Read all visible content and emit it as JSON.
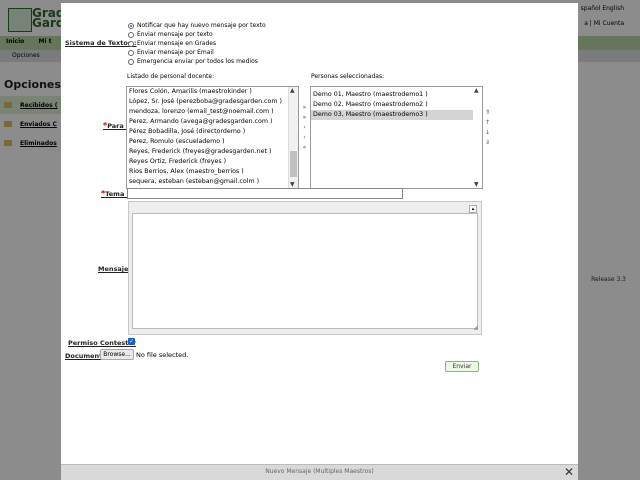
{
  "background": {
    "logo_text": "Grade\nGarde",
    "top_right_langs": "spañol  English",
    "top_right_user": "a | Mi Cuenta",
    "nav": [
      "Inicio",
      "Mi t"
    ],
    "subnav": [
      "Opciones"
    ],
    "page_title": "Opciones",
    "folders": [
      "Recibidos (",
      "Enviados C",
      "Eliminados"
    ],
    "release": "Release 3.3"
  },
  "dialog": {
    "title": "Nuevo Mensaje (Multiples Maestros)",
    "close_icon": "close-icon",
    "sistema_label": "Sistema de Textos :",
    "sms_options": [
      {
        "label": "Notificar que hay nuevo mensaje por texto",
        "selected": true
      },
      {
        "label": "Enviar mensaje por texto",
        "selected": false
      },
      {
        "label": "Enviar mensaje en Grades",
        "selected": false
      },
      {
        "label": "Enviar mensaje por Email",
        "selected": false
      },
      {
        "label": "Emergencia enviar por todos los medios",
        "selected": false
      }
    ],
    "staff_list_label": "Listado de personal docente:",
    "selected_list_label": "Personas seleccionadas:",
    "para_label": "Para :",
    "staff": [
      "Flores Colón, Amarilis (maestrokinder )",
      "López, Sr. José (perezboba@gradesgarden.com )",
      "mendoza, lorenzo (email_test@noemail.com )",
      "Perez, Armando (avega@gradesgarden.com )",
      "Pérez Bobadilla, José (directordemo )",
      "Perez, Romulo (escuelademo )",
      "Reyes, Frederick (freyes@gradesgarden.net )",
      "Reyes Ortiz, Frederick (freyes )",
      "Rios Berrios, Alex (maestro_berrios )",
      "sequera, esteban (esteban@gmail.colm )"
    ],
    "selected": [
      {
        "label": "Demo 01, Maestro (maestrodemo1 )",
        "highlighted": false
      },
      {
        "label": "Demo 02, Maestro (maestrodemo2 )",
        "highlighted": false
      },
      {
        "label": "Demo 03, Maestro (maestrodemo3 )",
        "highlighted": true
      }
    ],
    "tema_label": "Tema :",
    "tema_value": "",
    "mensaje_label": "Mensaje",
    "permiso_label": "Permiso Contestar",
    "permiso_checked": true,
    "documento_label": "Documento",
    "browse_label": "Browse...",
    "file_status": "No file selected.",
    "enviar_label": "Enviar"
  }
}
